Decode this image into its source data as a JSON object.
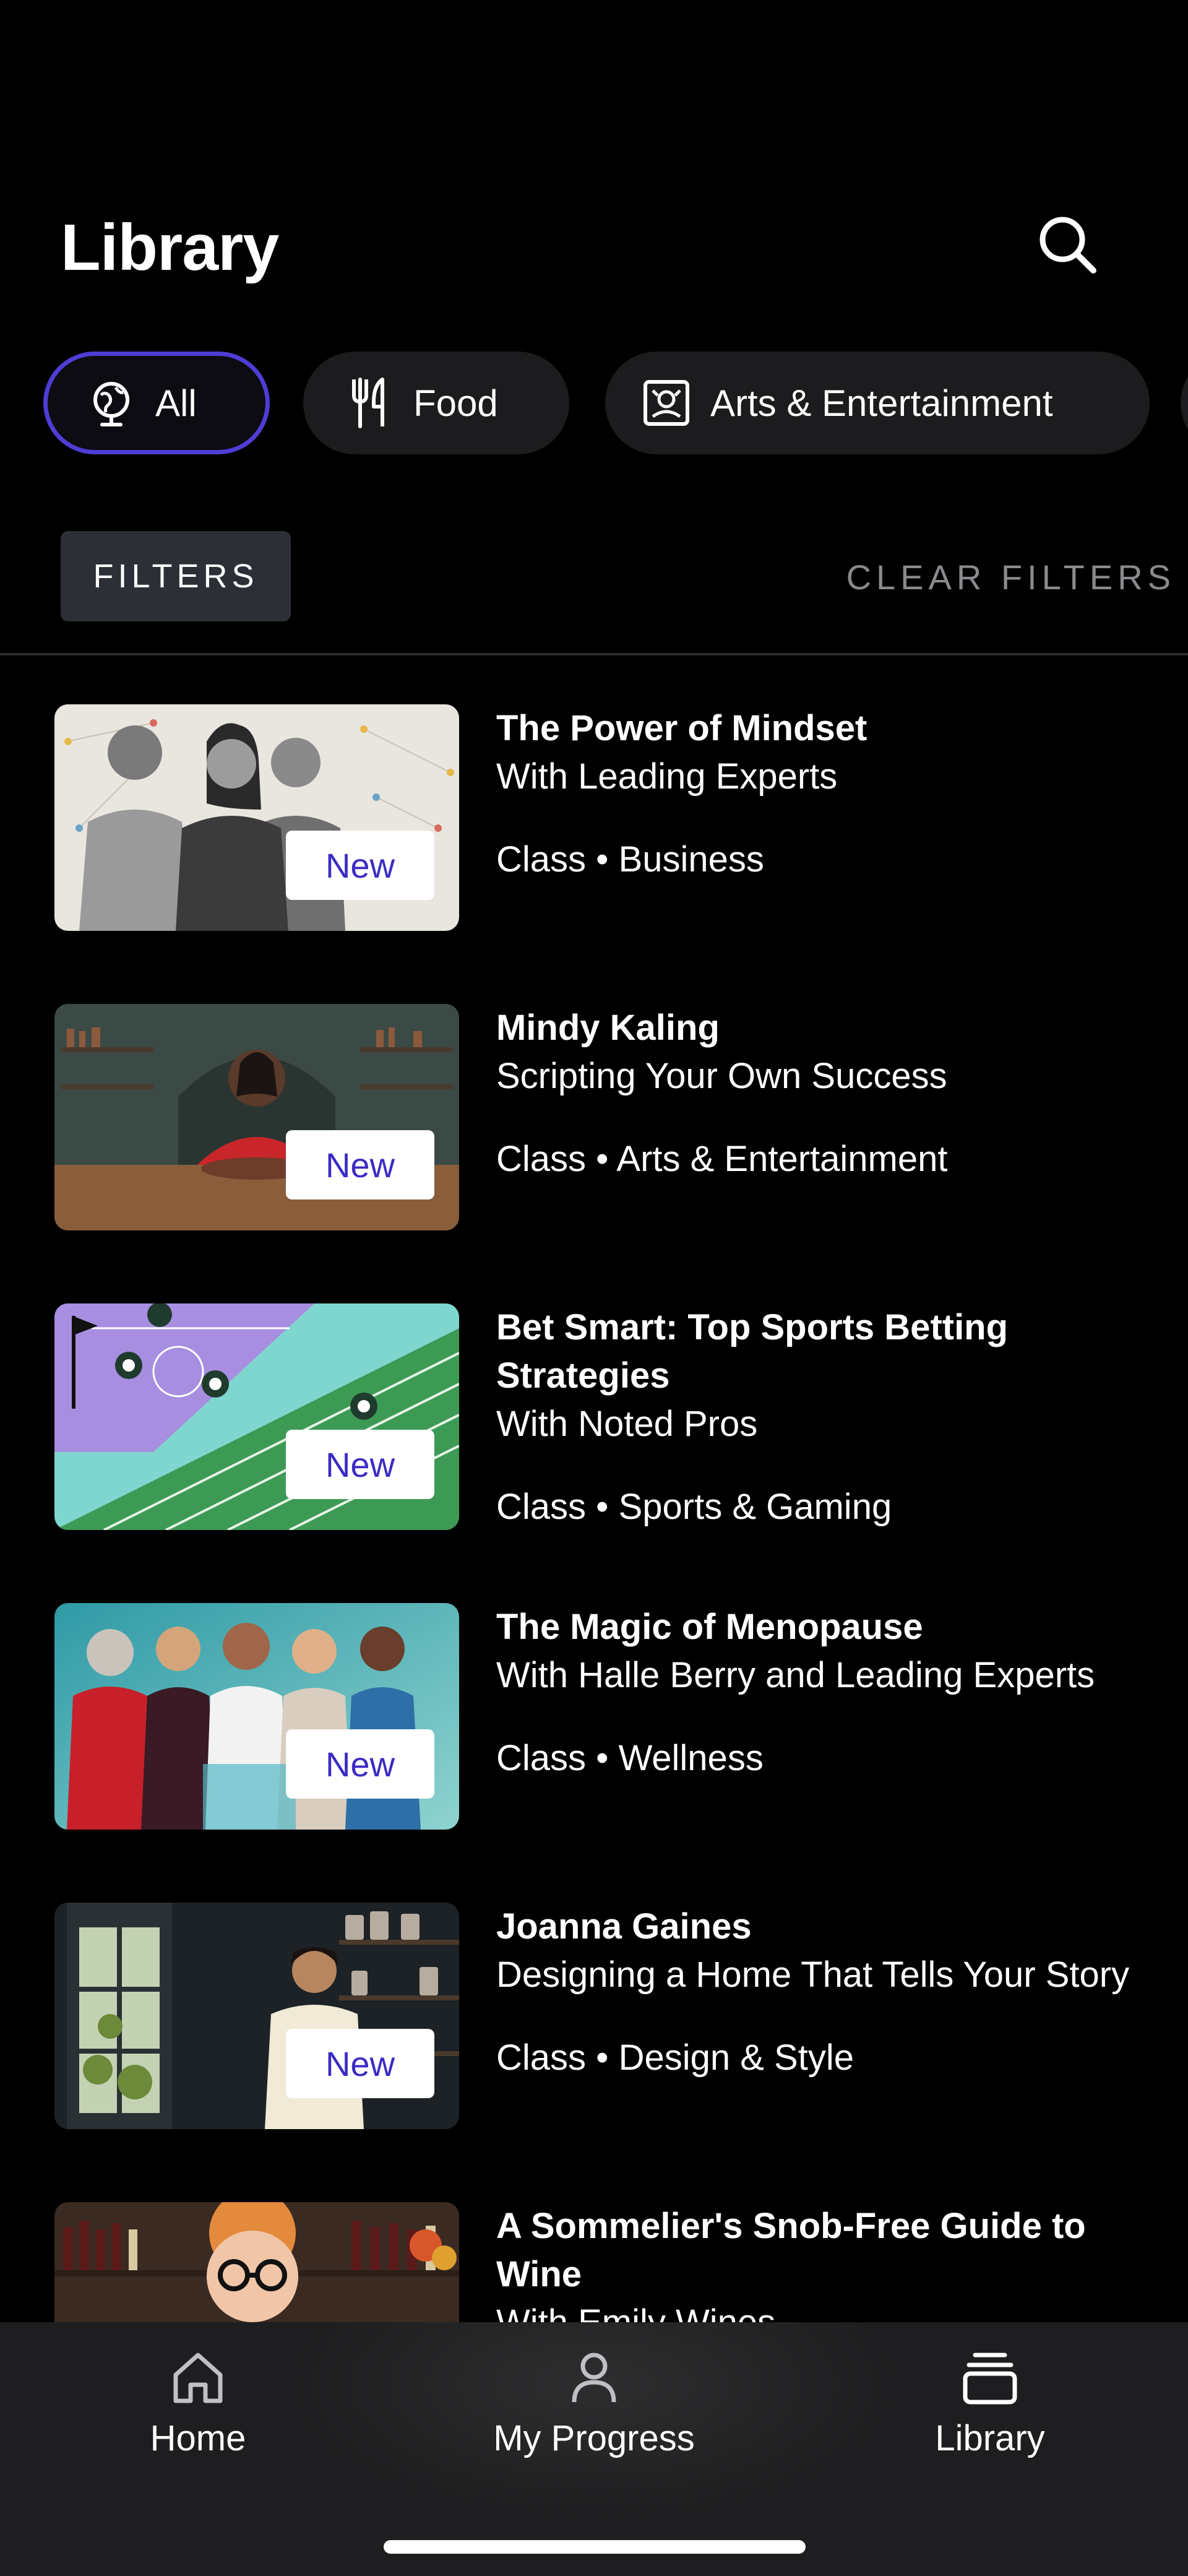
{
  "header": {
    "title": "Library",
    "search_icon": "search-icon"
  },
  "categories": [
    {
      "label": "All",
      "icon": "globe-icon",
      "active": true
    },
    {
      "label": "Food",
      "icon": "fork-knife-icon",
      "active": false
    },
    {
      "label": "Arts & Entertainment",
      "icon": "theater-icon",
      "active": false
    }
  ],
  "filters": {
    "filters_label": "FILTERS",
    "clear_label": "CLEAR FILTERS"
  },
  "classes": [
    {
      "title": "The Power of Mindset",
      "subtitle": "With Leading Experts",
      "type": "Class",
      "category": "Business",
      "badge": "New"
    },
    {
      "title": "Mindy Kaling",
      "subtitle": "Scripting Your Own Success",
      "type": "Class",
      "category": "Arts & Entertainment",
      "badge": "New"
    },
    {
      "title": "Bet Smart: Top Sports Betting Strategies",
      "subtitle": "With Noted Pros",
      "type": "Class",
      "category": "Sports & Gaming",
      "badge": "New"
    },
    {
      "title": "The Magic of Menopause",
      "subtitle": "With Halle Berry and Leading Experts",
      "type": "Class",
      "category": "Wellness",
      "badge": "New"
    },
    {
      "title": "Joanna Gaines",
      "subtitle": "Designing a Home That Tells Your Story",
      "type": "Class",
      "category": "Design & Style",
      "badge": "New"
    },
    {
      "title": "A Sommelier's Snob-Free Guide to Wine",
      "subtitle": "With Emily Wines",
      "type": "",
      "category": "",
      "badge": ""
    }
  ],
  "tabbar": [
    {
      "label": "Home",
      "icon": "home-icon"
    },
    {
      "label": "My Progress",
      "icon": "person-icon"
    },
    {
      "label": "Library",
      "icon": "library-stack-icon"
    }
  ],
  "colors": {
    "accent": "#4f3dd6",
    "badge_text": "#3b2bc4",
    "background": "#000000",
    "chip_bg": "#1c1c1e",
    "tabbar_bg": "#1e1e20"
  }
}
